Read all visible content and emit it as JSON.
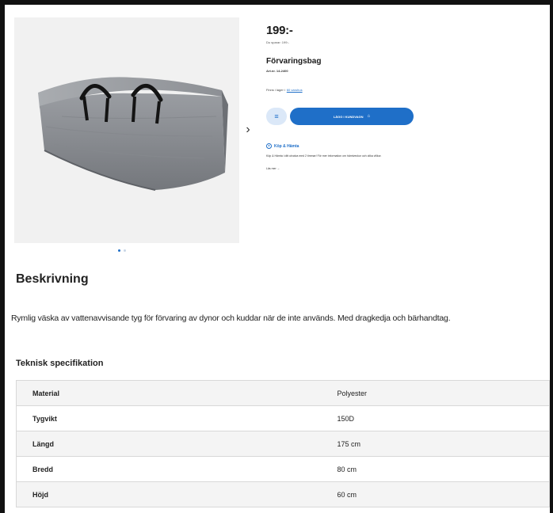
{
  "product": {
    "price": "199:-",
    "price_note": "Du sparar: 199:-",
    "name": "Förvaringsbag",
    "article_no": "Art.nr. 14-2400",
    "stock_text": "Finns i lager i",
    "stock_link": "60 varuhus"
  },
  "gallery": {
    "image_alt": "Förvaringsbag",
    "next_label": "›",
    "dot_count": 2,
    "active_dot": 0
  },
  "buttons": {
    "qty_icon": "≡",
    "add_to_cart": "LÄGG I KUNDVAGN",
    "cart_icon": "🛒"
  },
  "pickup": {
    "title": "Köp & Hämta",
    "text": "Köp & Hämta i ditt utvalva med 2 timmar! För mer information om hämtveckor och olika villkor.",
    "read_more": "Läs mer →"
  },
  "description": {
    "heading": "Beskrivning",
    "text": "Rymlig väska av vattenavvisande tyg för förvaring av dynor och kuddar när de inte används. Med dragkedja och bärhandtag."
  },
  "spec": {
    "heading": "Teknisk specifikation",
    "rows": [
      {
        "key": "Material",
        "value": "Polyester"
      },
      {
        "key": "Tygvikt",
        "value": "150D"
      },
      {
        "key": "Längd",
        "value": "175 cm"
      },
      {
        "key": "Bredd",
        "value": "80 cm"
      },
      {
        "key": "Höjd",
        "value": "60 cm"
      }
    ]
  },
  "colors": {
    "accent": "#1f6fc8",
    "bag": "#8a8d92"
  }
}
